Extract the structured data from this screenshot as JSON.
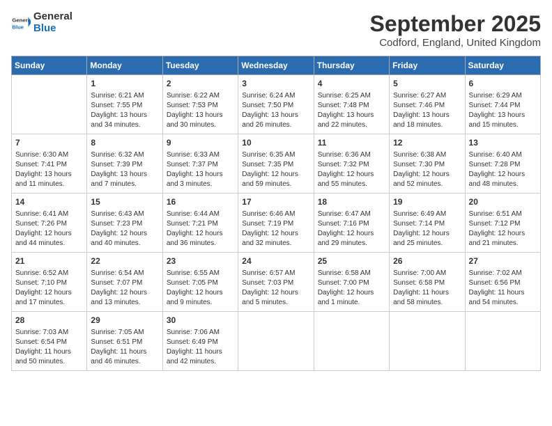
{
  "header": {
    "logo_line1": "General",
    "logo_line2": "Blue",
    "month_title": "September 2025",
    "location": "Codford, England, United Kingdom"
  },
  "calendar": {
    "weekdays": [
      "Sunday",
      "Monday",
      "Tuesday",
      "Wednesday",
      "Thursday",
      "Friday",
      "Saturday"
    ],
    "weeks": [
      [
        {
          "day": null,
          "info": null
        },
        {
          "day": "1",
          "info": "Sunrise: 6:21 AM\nSunset: 7:55 PM\nDaylight: 13 hours\nand 34 minutes."
        },
        {
          "day": "2",
          "info": "Sunrise: 6:22 AM\nSunset: 7:53 PM\nDaylight: 13 hours\nand 30 minutes."
        },
        {
          "day": "3",
          "info": "Sunrise: 6:24 AM\nSunset: 7:50 PM\nDaylight: 13 hours\nand 26 minutes."
        },
        {
          "day": "4",
          "info": "Sunrise: 6:25 AM\nSunset: 7:48 PM\nDaylight: 13 hours\nand 22 minutes."
        },
        {
          "day": "5",
          "info": "Sunrise: 6:27 AM\nSunset: 7:46 PM\nDaylight: 13 hours\nand 18 minutes."
        },
        {
          "day": "6",
          "info": "Sunrise: 6:29 AM\nSunset: 7:44 PM\nDaylight: 13 hours\nand 15 minutes."
        }
      ],
      [
        {
          "day": "7",
          "info": "Sunrise: 6:30 AM\nSunset: 7:41 PM\nDaylight: 13 hours\nand 11 minutes."
        },
        {
          "day": "8",
          "info": "Sunrise: 6:32 AM\nSunset: 7:39 PM\nDaylight: 13 hours\nand 7 minutes."
        },
        {
          "day": "9",
          "info": "Sunrise: 6:33 AM\nSunset: 7:37 PM\nDaylight: 13 hours\nand 3 minutes."
        },
        {
          "day": "10",
          "info": "Sunrise: 6:35 AM\nSunset: 7:35 PM\nDaylight: 12 hours\nand 59 minutes."
        },
        {
          "day": "11",
          "info": "Sunrise: 6:36 AM\nSunset: 7:32 PM\nDaylight: 12 hours\nand 55 minutes."
        },
        {
          "day": "12",
          "info": "Sunrise: 6:38 AM\nSunset: 7:30 PM\nDaylight: 12 hours\nand 52 minutes."
        },
        {
          "day": "13",
          "info": "Sunrise: 6:40 AM\nSunset: 7:28 PM\nDaylight: 12 hours\nand 48 minutes."
        }
      ],
      [
        {
          "day": "14",
          "info": "Sunrise: 6:41 AM\nSunset: 7:26 PM\nDaylight: 12 hours\nand 44 minutes."
        },
        {
          "day": "15",
          "info": "Sunrise: 6:43 AM\nSunset: 7:23 PM\nDaylight: 12 hours\nand 40 minutes."
        },
        {
          "day": "16",
          "info": "Sunrise: 6:44 AM\nSunset: 7:21 PM\nDaylight: 12 hours\nand 36 minutes."
        },
        {
          "day": "17",
          "info": "Sunrise: 6:46 AM\nSunset: 7:19 PM\nDaylight: 12 hours\nand 32 minutes."
        },
        {
          "day": "18",
          "info": "Sunrise: 6:47 AM\nSunset: 7:16 PM\nDaylight: 12 hours\nand 29 minutes."
        },
        {
          "day": "19",
          "info": "Sunrise: 6:49 AM\nSunset: 7:14 PM\nDaylight: 12 hours\nand 25 minutes."
        },
        {
          "day": "20",
          "info": "Sunrise: 6:51 AM\nSunset: 7:12 PM\nDaylight: 12 hours\nand 21 minutes."
        }
      ],
      [
        {
          "day": "21",
          "info": "Sunrise: 6:52 AM\nSunset: 7:10 PM\nDaylight: 12 hours\nand 17 minutes."
        },
        {
          "day": "22",
          "info": "Sunrise: 6:54 AM\nSunset: 7:07 PM\nDaylight: 12 hours\nand 13 minutes."
        },
        {
          "day": "23",
          "info": "Sunrise: 6:55 AM\nSunset: 7:05 PM\nDaylight: 12 hours\nand 9 minutes."
        },
        {
          "day": "24",
          "info": "Sunrise: 6:57 AM\nSunset: 7:03 PM\nDaylight: 12 hours\nand 5 minutes."
        },
        {
          "day": "25",
          "info": "Sunrise: 6:58 AM\nSunset: 7:00 PM\nDaylight: 12 hours\nand 1 minute."
        },
        {
          "day": "26",
          "info": "Sunrise: 7:00 AM\nSunset: 6:58 PM\nDaylight: 11 hours\nand 58 minutes."
        },
        {
          "day": "27",
          "info": "Sunrise: 7:02 AM\nSunset: 6:56 PM\nDaylight: 11 hours\nand 54 minutes."
        }
      ],
      [
        {
          "day": "28",
          "info": "Sunrise: 7:03 AM\nSunset: 6:54 PM\nDaylight: 11 hours\nand 50 minutes."
        },
        {
          "day": "29",
          "info": "Sunrise: 7:05 AM\nSunset: 6:51 PM\nDaylight: 11 hours\nand 46 minutes."
        },
        {
          "day": "30",
          "info": "Sunrise: 7:06 AM\nSunset: 6:49 PM\nDaylight: 11 hours\nand 42 minutes."
        },
        {
          "day": null,
          "info": null
        },
        {
          "day": null,
          "info": null
        },
        {
          "day": null,
          "info": null
        },
        {
          "day": null,
          "info": null
        }
      ]
    ]
  }
}
